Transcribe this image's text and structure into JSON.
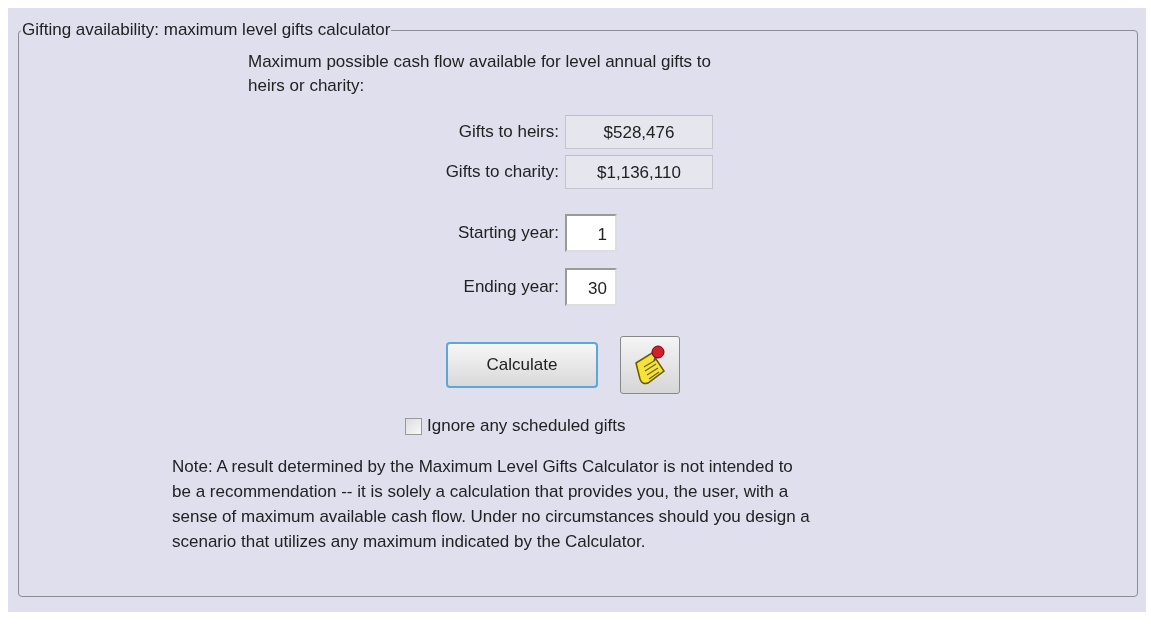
{
  "group": {
    "title": "Gifting availability: maximum level gifts calculator"
  },
  "intro": [
    "Maximum possible cash flow available for level annual gifts to",
    "heirs or charity:"
  ],
  "outputs": [
    {
      "label": "Gifts to heirs:",
      "value": "$528,476"
    },
    {
      "label": "Gifts to charity:",
      "value": "$1,136,110"
    }
  ],
  "inputs": [
    {
      "label": "Starting year:",
      "value": "1"
    },
    {
      "label": "Ending year:",
      "value": "30"
    }
  ],
  "calculate_button": {
    "label": "Calculate"
  },
  "ignore_checkbox": {
    "label": "Ignore any scheduled gifts",
    "checked": false
  },
  "note": [
    "Note: A result determined by the Maximum Level Gifts Calculator is not intended to",
    "be a recommendation -- it is solely a calculation that provides you, the user, with a",
    "sense of maximum available cash flow.  Under no circumstances should you design a",
    "scenario  that utilizes any maximum indicated by the Calculator."
  ]
}
